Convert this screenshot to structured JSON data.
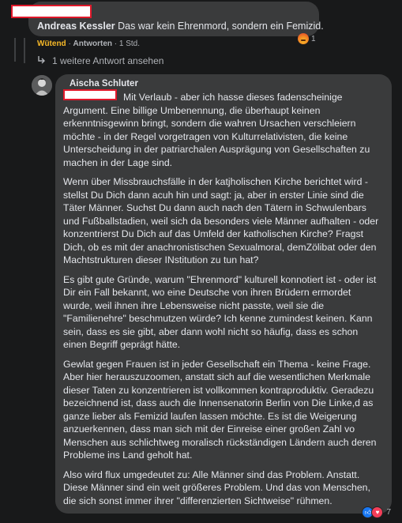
{
  "comment1": {
    "author": "Andreas Kessler",
    "text": "Das war kein Ehrenmord, sondern ein Femizid.",
    "reaction_label": "Wütend",
    "reply_label": "Antworten",
    "time": "1 Std.",
    "reaction_count": "1",
    "reaction_icon": "angry-icon"
  },
  "more_replies": {
    "label": "1 weitere Antwort ansehen"
  },
  "comment2": {
    "author": "Aischa Schluter",
    "paragraphs": [
      "Mit Verlaub - aber ich hasse dieses fadenscheinige Argument. Eine billige Umbenennung, die überhaupt keinen erkenntnisgewinn bringt, sondern die wahren Ursachen verschleiern möchte - in der Regel vorgetragen von Kulturrelativisten, die keine Unterscheidung in der patriarchalen Ausprägung von Gesellschaften zu machen in der Lage sind.",
      "Wenn über Missbrauchsfälle in der katjholischen Kirche berichtet wird - stellst Du Dich dann acuh hin und sagt: ja, aber in erster Linie sind die Täter Männer. Suchst Du dann auch nach den Tätern in Schwulenbars und Fußballstadien, weil sich da besonders viele Männer aufhalten - oder konzentrierst Du Dich auf das Umfeld der katholischen Kirche? Fragst Dich, ob es mit der anachronistischen Sexualmoral, demZölibat oder den Machtstrukturen dieser INstitution zu tun hat?",
      "Es gibt gute Gründe, warum \"Ehrenmord\" kulturell konnotiert ist - oder ist Dir ein Fall bekannt, wo eine Deutsche von ihren Brüdern ermordet wurde, weil ihnen ihre Lebensweise nicht passte, weil sie die \"Familienehre\" beschmutzen würde? Ich kenne zumindest keinen. Kann sein, dass es sie gibt, aber dann wohl nicht so häufig, dass es schon einen Begriff geprägt hätte.",
      "Gewlat gegen Frauen ist in jeder Gesellschaft ein Thema - keine Frage. Aber hier herauszuzoomen, anstatt sich auf die wesentlichen Merkmale dieser Taten zu konzentrieren ist vollkommen kontraproduktiv. Geradezu bezeichnend ist, dass auch die Innensenatorin Berlin von Die Linke,d as ganze lieber als Femizid laufen lassen möchte. Es ist die Weigerung anzuerkennen, dass man sich mit der Einreise einer großen Zahl vo Menschen aus schlichtweg moralisch rückständigen Ländern auch deren Probleme ins Land geholt hat.",
      "Also wird flux umgedeutet zu: Alle Männer sind das Problem. Anstatt. Diese Männer sind ein weit größeres Problem. Und das von Menschen, die sich sonst immer ihrer \"differenzierten Sichtweise\" rühmen."
    ],
    "reaction_count": "7",
    "reaction_icons": [
      "like-icon",
      "love-icon"
    ]
  },
  "colors": {
    "background": "#18191a",
    "bubble": "#3a3b3c",
    "angry_label": "#f7b928",
    "redaction_border": "#e0192b"
  }
}
